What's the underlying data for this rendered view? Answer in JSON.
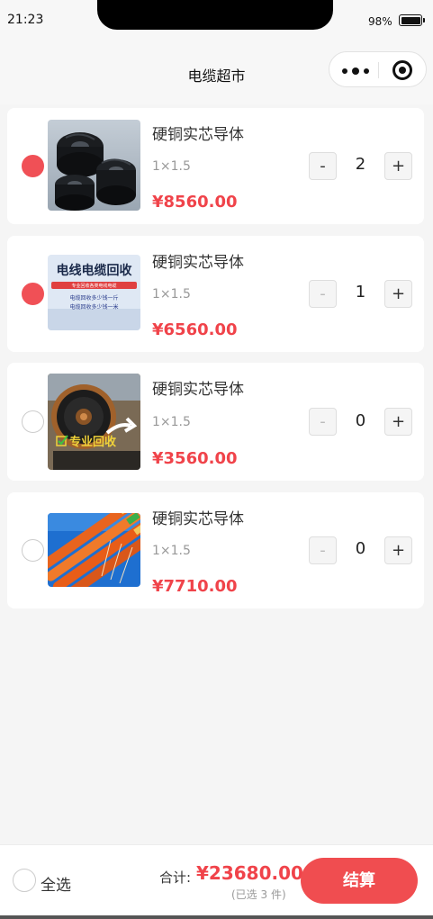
{
  "status_bar": {
    "time": "21:23",
    "battery": "98%"
  },
  "nav": {
    "title": "电缆超市"
  },
  "items": [
    {
      "name": "硬铜实芯导体",
      "spec": "1×1.5",
      "price": "¥8560.00",
      "qty": "2",
      "checked": true,
      "minus": "-",
      "plus": "+"
    },
    {
      "name": "硬铜实芯导体",
      "spec": "1×1.5",
      "price": "¥6560.00",
      "qty": "1",
      "checked": true,
      "minus": "-",
      "plus": "+",
      "image_text": {
        "title": "电线电缆回收",
        "banner": "专业回收各类电线电缆",
        "line1": "电缆回收多少钱一斤",
        "line2": "电缆回收多少钱一米"
      }
    },
    {
      "name": "硬铜实芯导体",
      "spec": "1×1.5",
      "price": "¥3560.00",
      "qty": "0",
      "checked": false,
      "minus": "-",
      "plus": "+",
      "image_text": {
        "badge": "专业回收"
      }
    },
    {
      "name": "硬铜实芯导体",
      "spec": "1×1.5",
      "price": "¥7710.00",
      "qty": "0",
      "checked": false,
      "minus": "-",
      "plus": "+"
    }
  ],
  "footer": {
    "select_all": "全选",
    "total_label": "合计:",
    "total_value": "¥23680.00",
    "selected_count": "(已选 3 件)",
    "checkout": "结算"
  },
  "colors": {
    "accent": "#f0434a",
    "checkout": "#f04d50",
    "background": "#f5f5f5"
  }
}
